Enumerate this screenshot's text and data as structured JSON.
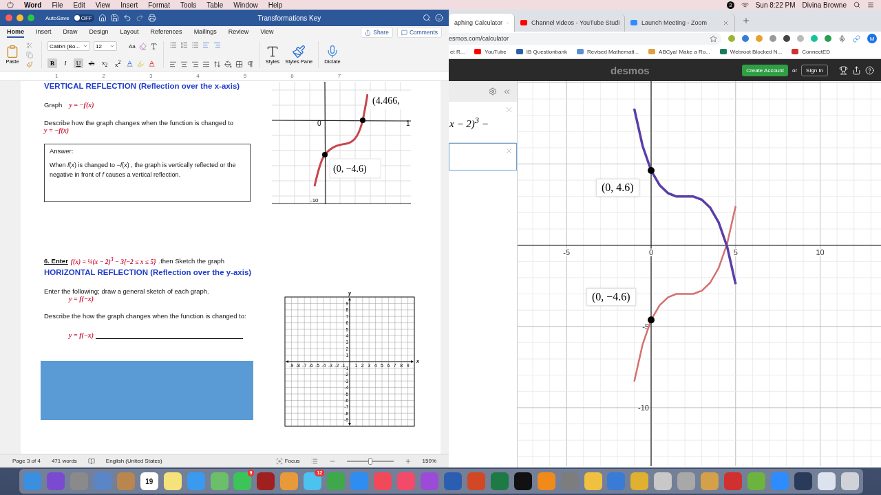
{
  "menu_bar": {
    "app": "Word",
    "items": [
      "File",
      "Edit",
      "View",
      "Insert",
      "Format",
      "Tools",
      "Table",
      "Window",
      "Help"
    ],
    "badge": "3",
    "clock": "Sun 8:22 PM",
    "user": "Divina Browne"
  },
  "word": {
    "autosave": {
      "label": "AutoSave",
      "state": "OFF",
      "on": false
    },
    "title": "Transformations Key",
    "tabs": [
      {
        "label": "Home",
        "selected": true
      },
      {
        "label": "Insert",
        "selected": false
      },
      {
        "label": "Draw",
        "selected": false
      },
      {
        "label": "Design",
        "selected": false
      },
      {
        "label": "Layout",
        "selected": false
      },
      {
        "label": "References",
        "selected": false
      },
      {
        "label": "Mailings",
        "selected": false
      },
      {
        "label": "Review",
        "selected": false
      },
      {
        "label": "View",
        "selected": false
      }
    ],
    "share": "Share",
    "comments": "Comments",
    "paste": "Paste",
    "font": "Calibri (Bo...",
    "size": "12",
    "case": "Aa",
    "format_buttons": [
      {
        "kind": "bold",
        "label": "B",
        "pressed": true
      },
      {
        "kind": "italic",
        "label": "I",
        "pressed": false
      },
      {
        "kind": "underline",
        "label": "U",
        "pressed": true
      },
      {
        "kind": "strike",
        "label": "ab",
        "pressed": false
      },
      {
        "kind": "sub",
        "label": "x$_{2}$",
        "pressed": false
      },
      {
        "kind": "sup",
        "label": "x$^{2}$",
        "pressed": false
      }
    ],
    "styles": "Styles",
    "styles_pane": "Styles Pane",
    "dictate": "Dictate",
    "ruler": [
      "1",
      "2",
      "3",
      "4",
      "5",
      "6",
      "7"
    ],
    "document": {
      "section1": {
        "heading": "VERTICAL REFLECTION (Reflection over the x-axis)",
        "graph_label": "Graph",
        "graph_eq": "y = −f(x)",
        "describe": "Describe how the graph changes when the function is changed to",
        "describe_eq": "y = −f(x)",
        "answer_title": "Answer:",
        "answer": "When *f*(*x*) is changed to −*f*(*x*) , the graph is vertically reflected or the negative in front of *f* causes a vertical reflection.",
        "graph_image": {
          "point_labels": [
            "(4.466,",
            "(0, −4.6)"
          ],
          "tick_labels": [
            "0",
            "1",
            "-10"
          ]
        }
      },
      "section2": {
        "number": "6.  Enter",
        "formula": "f(x) = ¼(x − 2)$^{3}$ − 3{−2 ≤ x ≤ 5}",
        "formula_tail": ".then Sketch the graph",
        "heading": "HORIZONTAL REFLECTION (Reflection over the y-axis)",
        "instruction": "Enter the following; draw a general sketch of each graph.",
        "eq": "y = f(−x)",
        "describe": "Describe the how the graph changes when the function is changed to:",
        "answer_eq": "y = f(−x)",
        "grid": {
          "x_label": "x",
          "y_label": "y",
          "x_ticks": [
            "-9",
            "-8",
            "-7",
            "-6",
            "-5",
            "-4",
            "-3",
            "-2",
            "-1",
            "1",
            "2",
            "3",
            "4",
            "5",
            "6",
            "7",
            "8",
            "9"
          ],
          "y_ticks": [
            "9",
            "8",
            "7",
            "6",
            "5",
            "4",
            "3",
            "2",
            "1",
            "-1",
            "-2",
            "-3",
            "-4",
            "-5",
            "-6",
            "-7",
            "-8",
            "-9"
          ]
        }
      }
    },
    "status": {
      "page": "Page 3 of 4",
      "words": "471 words",
      "language": "English (United States)",
      "focus": "Focus",
      "zoom": "150%",
      "zoom_level": {
        "level": 0.5
      }
    }
  },
  "browser": {
    "tabs": [
      {
        "title": "aphing Calculator",
        "selected": true
      },
      {
        "title": "Channel videos - YouTube Studi",
        "selected": false,
        "color": "#ff0000"
      },
      {
        "title": "Launch Meeting - Zoom",
        "selected": false,
        "color": "#2d8cff"
      }
    ],
    "url": "esmos.com/calculator",
    "extensions": [
      {
        "color": "#9bb53a"
      },
      {
        "color": "#3a7bd5"
      },
      {
        "color": "#e8a030"
      },
      {
        "color": "#9a9a9a"
      },
      {
        "color": "#444444"
      },
      {
        "color": "#bbbbbb"
      },
      {
        "color": "#15c39a"
      },
      {
        "color": "#2a9d50"
      }
    ],
    "profile": "M",
    "bookmarks": [
      {
        "label": "et R..."
      },
      {
        "label": "YouTube",
        "color": "#ff0000"
      },
      {
        "label": "IB Questionbank",
        "color": "#2b5fa8"
      },
      {
        "label": "Revised Mathemati...",
        "color": "#5b8fd0"
      },
      {
        "label": "ABCya! Make a Ro...",
        "color": "#e0a040"
      },
      {
        "label": "Webroot Blocked N...",
        "color": "#1a7a5a"
      },
      {
        "label": "ConnectED",
        "color": "#d32f2f"
      }
    ]
  },
  "desmos": {
    "logo": "desmos",
    "create": "Create Account",
    "or": "or",
    "sign_in": "Sign In",
    "expressions": [
      {
        "text": "x − 2)$^{3}$ −",
        "selected": false
      },
      {
        "selected": true
      }
    ],
    "chart_data": {
      "type": "line",
      "x": [
        -1,
        -0.5,
        0,
        0.5,
        1,
        1.5,
        2,
        2.5,
        3,
        3.5,
        4,
        4.5,
        5
      ],
      "grid": true,
      "series": [
        {
          "color": "#d4706f",
          "values": [
            -8.4,
            -6.1,
            -4.6,
            -3.7,
            -3.2,
            -3,
            -3,
            -3,
            -2.8,
            -2.3,
            -1.4,
            0.1,
            2.4
          ]
        },
        {
          "color": "#5a3ea8",
          "values": [
            8.4,
            6.1,
            4.6,
            3.7,
            3.2,
            3,
            3,
            3,
            2.8,
            2.3,
            1.4,
            -0.1,
            -2.4
          ]
        }
      ],
      "xlim": [
        -7.9,
        13.6
      ],
      "ylim": [
        -13.6,
        10.1
      ],
      "xticks": [
        -5,
        0,
        5,
        10
      ],
      "yticks": [
        -10,
        -5
      ],
      "annotations": [
        {
          "x": 0,
          "y": 4.6,
          "text": "(0, 4.6)"
        },
        {
          "x": 0,
          "y": -4.6,
          "text": "(0, −4.6)"
        }
      ]
    }
  },
  "dock": [
    {
      "color": "#3b8fe0"
    },
    {
      "color": "#7a4bd1"
    },
    {
      "color": "#8a8a8a"
    },
    {
      "color": "#5a86c8"
    },
    {
      "color": "#b8864e"
    },
    {
      "color": "#ffffff",
      "label": "19"
    },
    {
      "color": "#f5e27a"
    },
    {
      "color": "#3a9af0"
    },
    {
      "color": "#6bbf6b"
    },
    {
      "color": "#3cc35a",
      "badge": "9"
    },
    {
      "color": "#a02020"
    },
    {
      "color": "#e89a3a"
    },
    {
      "color": "#4cc2f0",
      "badge": "12"
    },
    {
      "color": "#3fa84a"
    },
    {
      "color": "#2f8cf0"
    },
    {
      "color": "#f04a5a"
    },
    {
      "color": "#f44a6a"
    },
    {
      "color": "#9b4bd8"
    },
    {
      "color": "#2b5eb0"
    },
    {
      "color": "#d24726"
    },
    {
      "color": "#1e7a45"
    },
    {
      "color": "#111111"
    },
    {
      "color": "#f08a1a"
    },
    {
      "color": "#7d7d7d"
    },
    {
      "color": "#f0c040"
    },
    {
      "color": "#3a7bd5"
    },
    {
      "color": "#e0b030"
    },
    {
      "color": "#c8c8c8"
    },
    {
      "color": "#a8a8a8"
    },
    {
      "color": "#d4a04a"
    },
    {
      "color": "#d03030"
    },
    {
      "color": "#6db33f"
    },
    {
      "color": "#2d8cff"
    },
    {
      "color": "#2a3a5a"
    },
    {
      "color": "#dde3ee"
    },
    {
      "color": "#cfd3d8"
    }
  ]
}
